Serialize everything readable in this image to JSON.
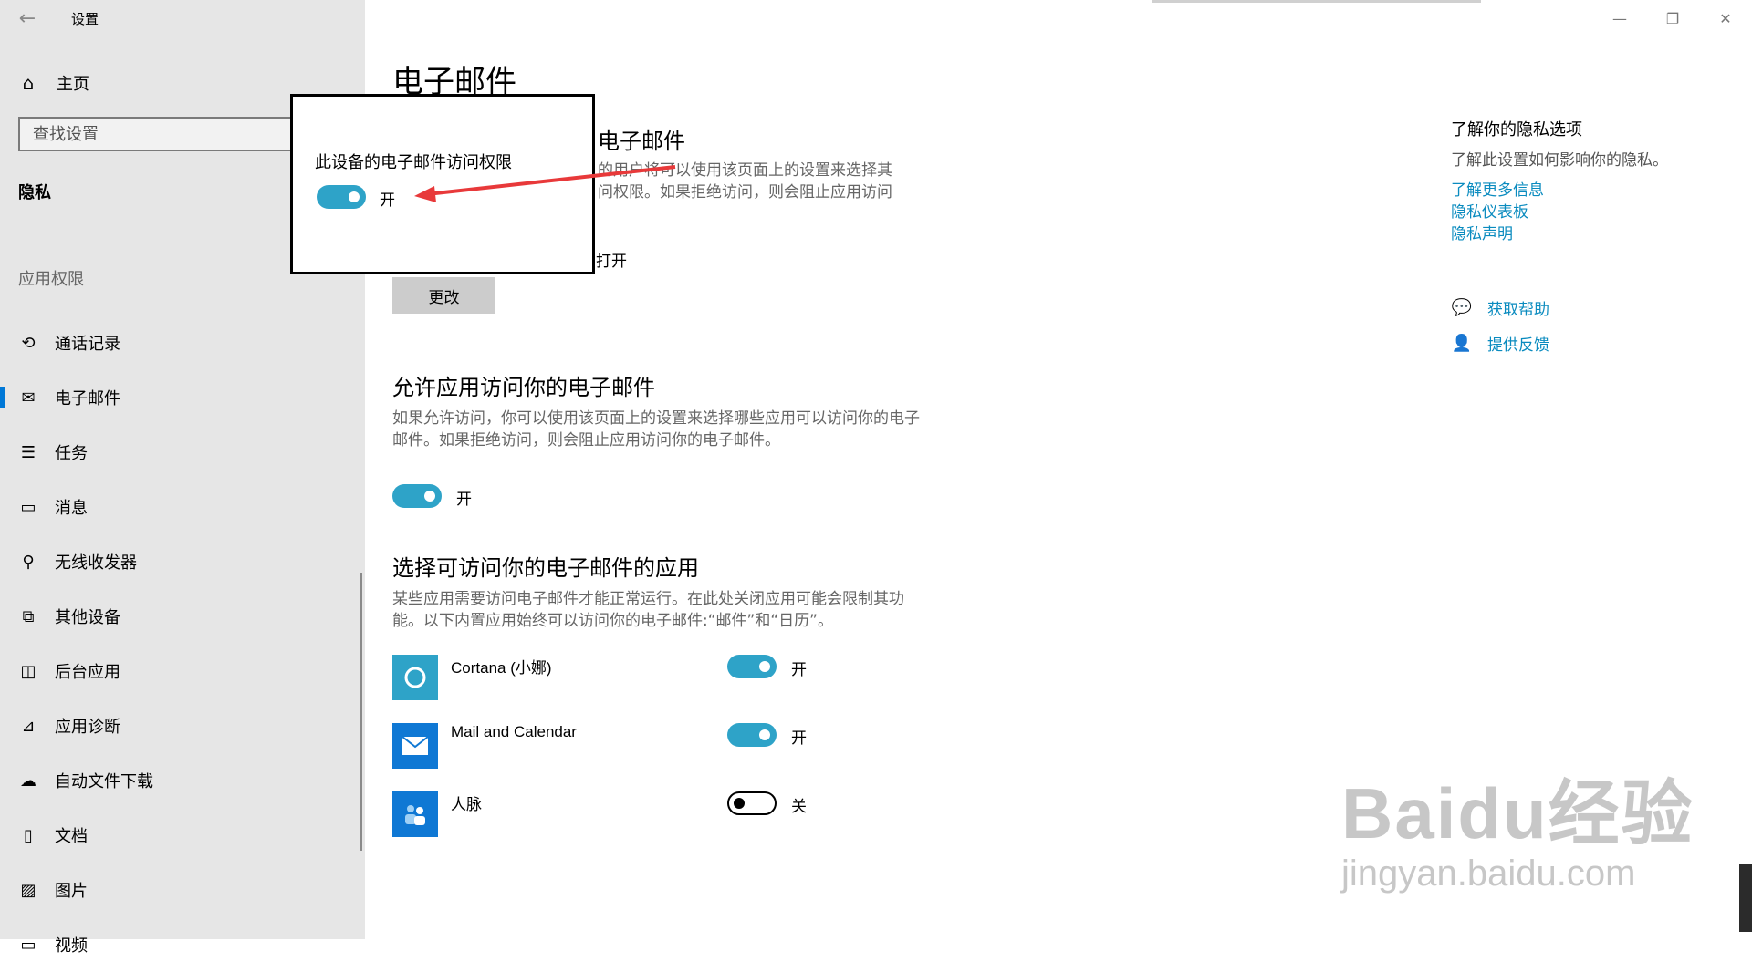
{
  "window": {
    "title": "设置"
  },
  "sidebar": {
    "home_label": "主页",
    "search_placeholder": "查找设置",
    "category": "隐私",
    "section_label": "应用权限",
    "items": [
      {
        "label": "通话记录",
        "icon": "history-icon"
      },
      {
        "label": "电子邮件",
        "icon": "mail-icon",
        "active": true
      },
      {
        "label": "任务",
        "icon": "tasks-icon"
      },
      {
        "label": "消息",
        "icon": "message-icon"
      },
      {
        "label": "无线收发器",
        "icon": "radio-icon"
      },
      {
        "label": "其他设备",
        "icon": "devices-icon"
      },
      {
        "label": "后台应用",
        "icon": "background-apps-icon"
      },
      {
        "label": "应用诊断",
        "icon": "diagnostics-icon"
      },
      {
        "label": "自动文件下载",
        "icon": "cloud-icon"
      },
      {
        "label": "文档",
        "icon": "document-icon"
      },
      {
        "label": "图片",
        "icon": "picture-icon"
      },
      {
        "label": "视频",
        "icon": "video-icon"
      }
    ]
  },
  "main": {
    "page_title": "电子邮件",
    "section1": {
      "heading_visible": "电子邮件",
      "desc_line1": "的用户将可以使用该页面上的设置来选择其",
      "desc_line2": "问权限。如果拒绝访问，则会阻止应用访问",
      "status_fragment": "打开",
      "change_button": "更改"
    },
    "section2": {
      "heading": "允许应用访问你的电子邮件",
      "desc": "如果允许访问，你可以使用该页面上的设置来选择哪些应用可以访问你的电子邮件。如果拒绝访问，则会阻止应用访问你的电子邮件。",
      "toggle_label": "开"
    },
    "section3": {
      "heading": "选择可访问你的电子邮件的应用",
      "desc": "某些应用需要访问电子邮件才能正常运行。在此处关闭应用可能会限制其功能。以下内置应用始终可以访问你的电子邮件:“邮件”和“日历”。",
      "apps": [
        {
          "name": "Cortana (小娜)",
          "toggle": "开",
          "on": true,
          "color": "#2ea3c8"
        },
        {
          "name": "Mail and Calendar",
          "toggle": "开",
          "on": true,
          "color": "#0f78d4"
        },
        {
          "name": "人脉",
          "toggle": "关",
          "on": false,
          "color": "#0f78d4"
        }
      ]
    }
  },
  "right": {
    "title": "了解你的隐私选项",
    "desc": "了解此设置如何影响你的隐私。",
    "links": [
      "了解更多信息",
      "隐私仪表板",
      "隐私声明"
    ],
    "help": "获取帮助",
    "feedback": "提供反馈"
  },
  "callout": {
    "title": "此设备的电子邮件访问权限",
    "toggle_label": "开"
  },
  "watermark": {
    "big": "Baidu经验",
    "small": "jingyan.baidu.com"
  },
  "colors": {
    "accent": "#2ea3c8",
    "link": "#0a8bbf",
    "sidebar_bg": "#e6e6e6",
    "annotation_arrow": "#e8393a"
  }
}
